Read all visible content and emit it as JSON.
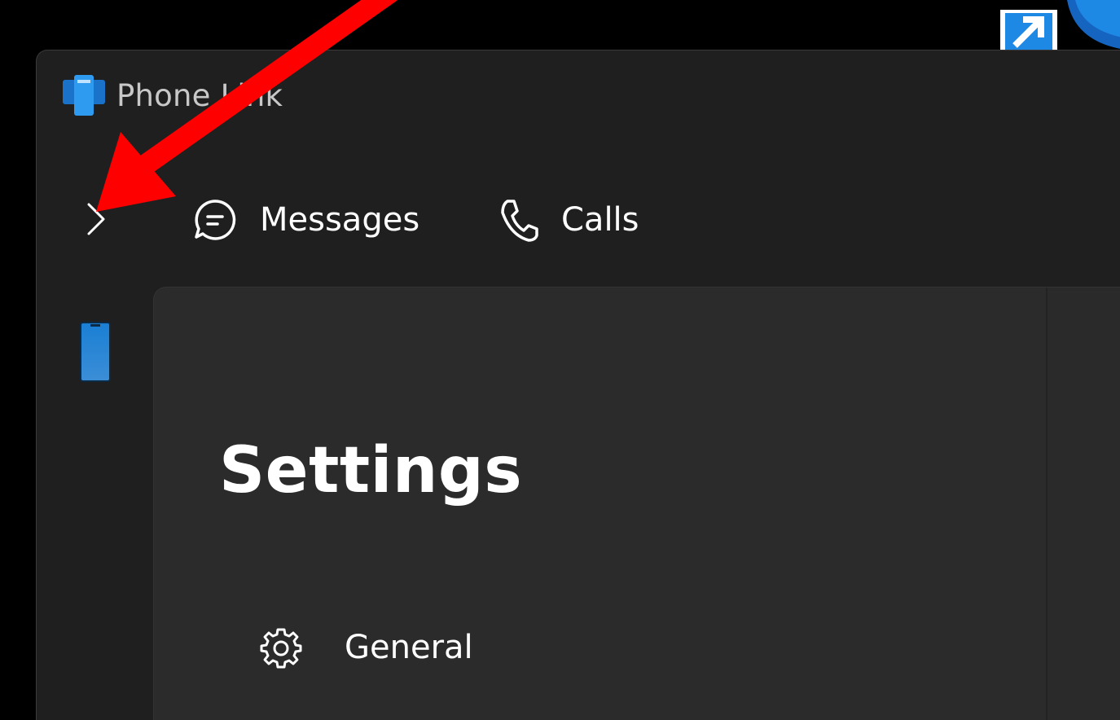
{
  "window": {
    "app_title": "Phone Link",
    "app_icon": "phone-link-app-icon"
  },
  "navigation": {
    "expand_icon": "chevron-right-icon",
    "tabs": [
      {
        "label": "Messages",
        "icon": "chat-bubble-icon"
      },
      {
        "label": "Calls",
        "icon": "phone-handset-icon"
      }
    ]
  },
  "side_rail": {
    "device_icon": "phone-device-icon"
  },
  "page": {
    "title": "Settings",
    "items": [
      {
        "label": "General",
        "icon": "gear-icon"
      }
    ]
  },
  "colors": {
    "background": "#000000",
    "window": "#1f1f1f",
    "panel": "#2b2b2b",
    "text": "#ffffff",
    "title_text": "#c8c8c8",
    "accent_blue": "#1a7fd4",
    "annotation_arrow": "#ff0000"
  }
}
